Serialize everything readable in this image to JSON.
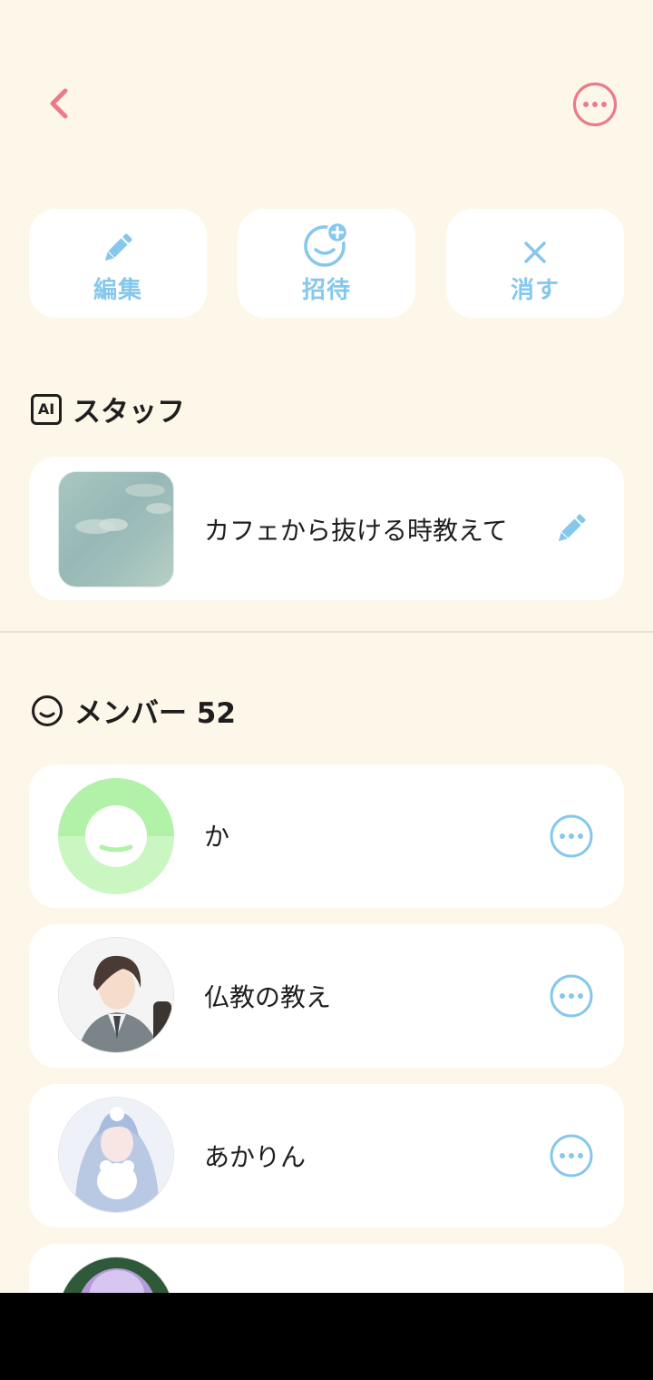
{
  "header": {
    "back_icon": "chevron-left-icon",
    "more_icon": "more-horizontal-circle-icon",
    "accent_color": "#EA7A8C"
  },
  "actions": [
    {
      "label": "編集",
      "icon": "pencil-icon"
    },
    {
      "label": "招待",
      "icon": "add-person-smile-icon"
    },
    {
      "label": "消す",
      "icon": "close-icon"
    }
  ],
  "action_color": "#86C7EC",
  "staff": {
    "title": "スタッフ",
    "badge": "AI",
    "item": {
      "text": "カフェから抜ける時教えて",
      "edit_icon": "pencil-icon"
    }
  },
  "members": {
    "title": "メンバー 52",
    "icon": "smile-icon",
    "items": [
      {
        "name": "か",
        "avatar": "default-green-smile-avatar"
      },
      {
        "name": "仏教の教え",
        "avatar": "anime-boy-avatar"
      },
      {
        "name": "あかりん",
        "avatar": "anime-girl-avatar"
      },
      {
        "name": "",
        "avatar": "anime-purple-avatar"
      }
    ]
  }
}
